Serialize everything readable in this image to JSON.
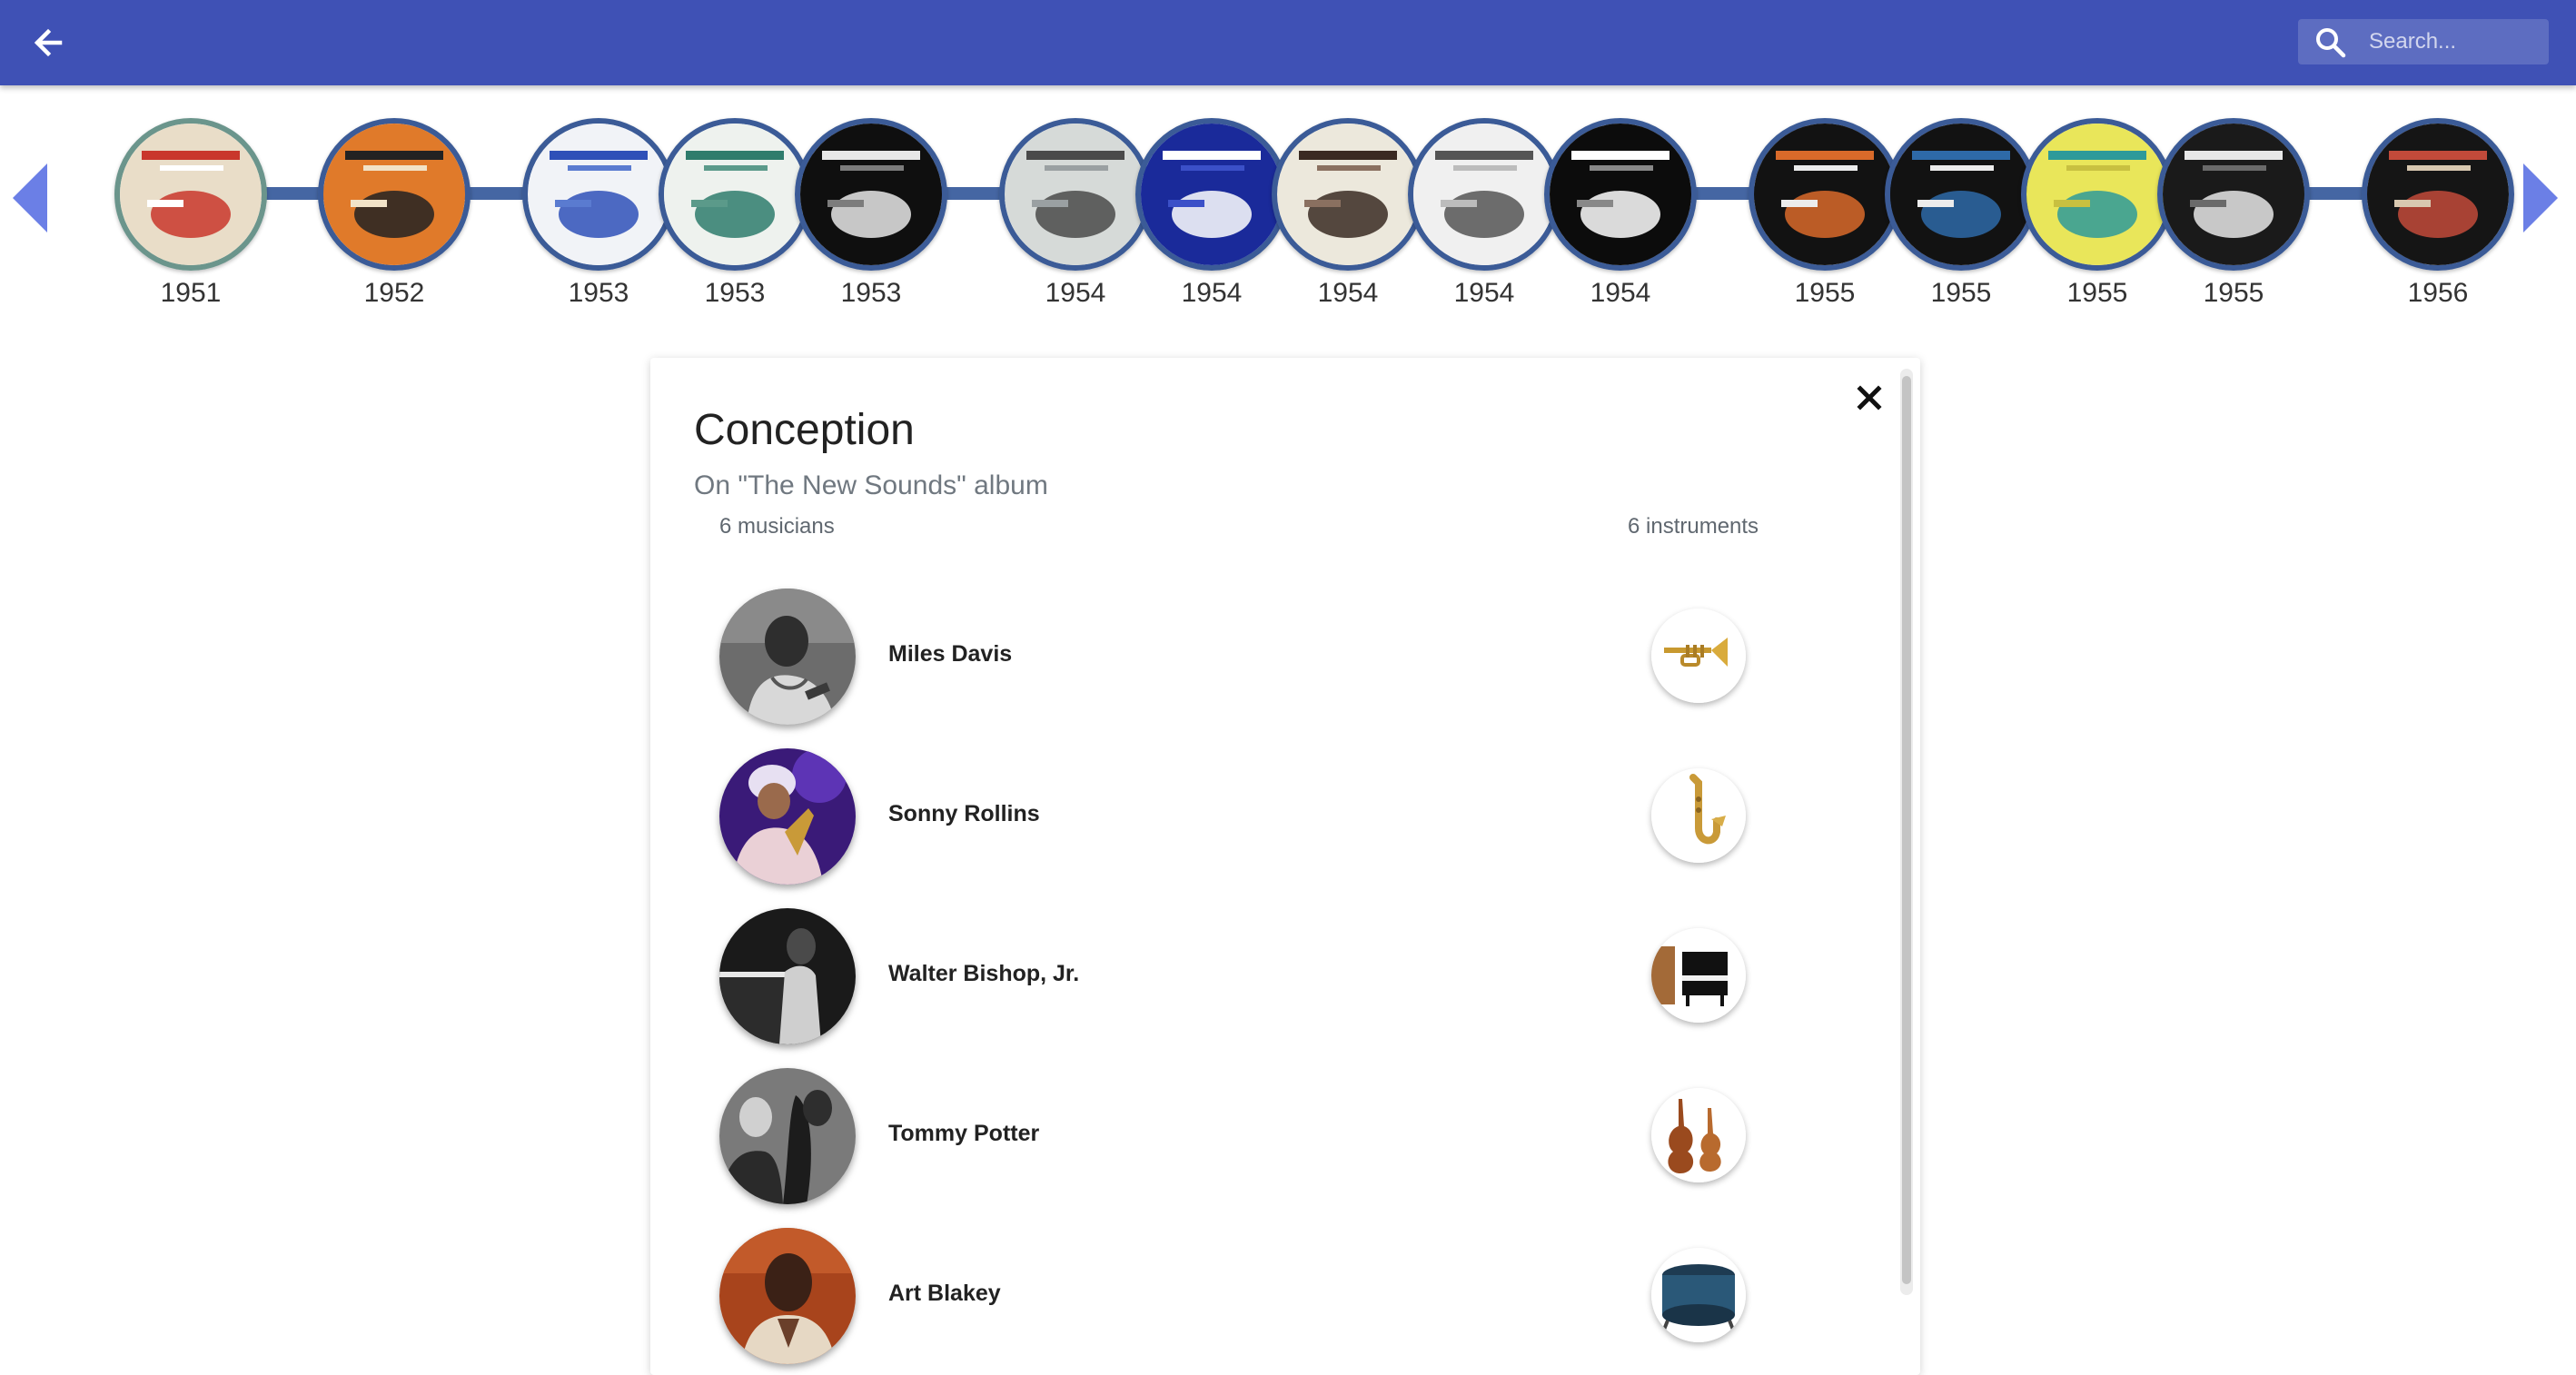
{
  "appbar": {
    "back_icon": "arrow-left-icon",
    "search": {
      "placeholder": "Search...",
      "value": "",
      "icon": "search-icon"
    },
    "color": "#3f51b5"
  },
  "timeline": {
    "prev_icon": "triangle-left-icon",
    "next_icon": "triangle-right-icon",
    "arrow_color": "#6b7fe6",
    "line_color": "#4566a3",
    "albums": [
      {
        "year": "1951",
        "selected": true
      },
      {
        "year": "1952"
      },
      {
        "year": "1953"
      },
      {
        "year": "1953"
      },
      {
        "year": "1953"
      },
      {
        "year": "1954"
      },
      {
        "year": "1954"
      },
      {
        "year": "1954"
      },
      {
        "year": "1954"
      },
      {
        "year": "1954"
      },
      {
        "year": "1955"
      },
      {
        "year": "1955"
      },
      {
        "year": "1955"
      },
      {
        "year": "1955"
      },
      {
        "year": "1956"
      }
    ]
  },
  "detail": {
    "close_icon": "close-icon",
    "title": "Conception",
    "subtitle": "On \"The New Sounds\" album",
    "musicians_count": "6 musicians",
    "instruments_count": "6 instruments",
    "members": [
      {
        "name": "Miles Davis",
        "instrument_icon": "trumpet-icon"
      },
      {
        "name": "Sonny Rollins",
        "instrument_icon": "saxophone-icon"
      },
      {
        "name": "Walter Bishop, Jr.",
        "instrument_icon": "piano-icon"
      },
      {
        "name": "Tommy Potter",
        "instrument_icon": "double-bass-icon"
      },
      {
        "name": "Art Blakey",
        "instrument_icon": "drums-icon"
      }
    ]
  }
}
